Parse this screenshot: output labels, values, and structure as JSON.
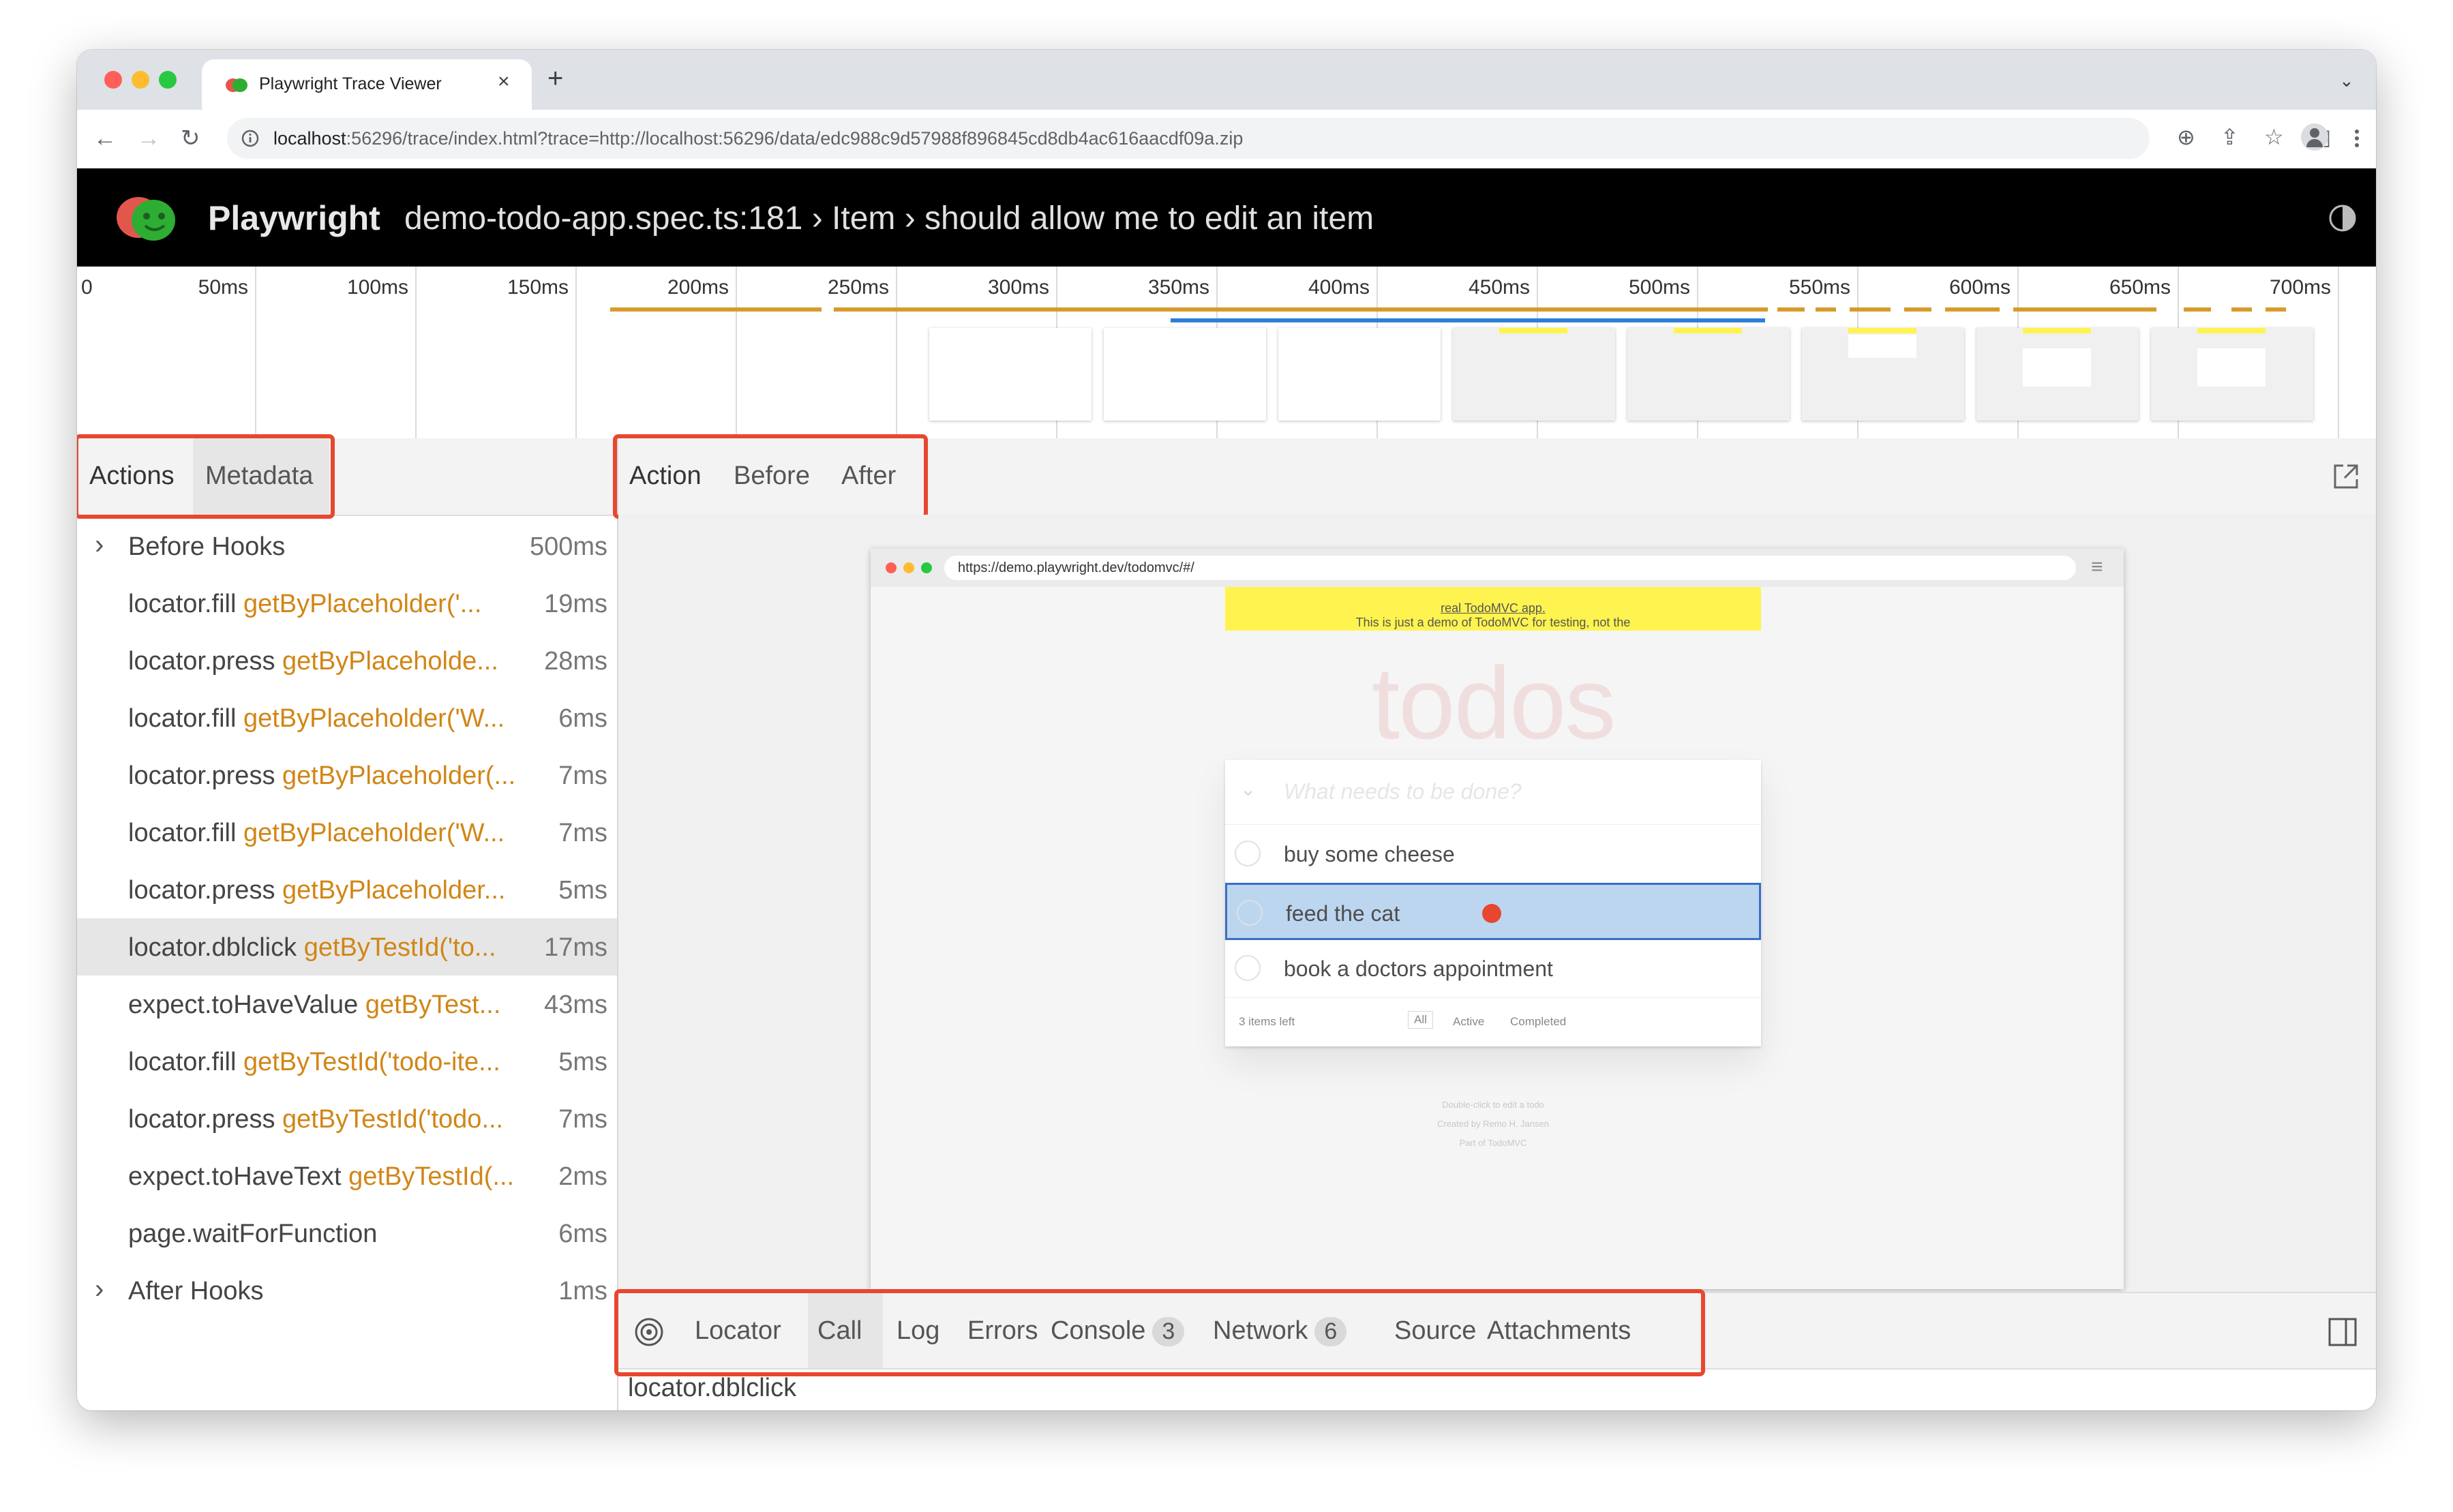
{
  "browser": {
    "tab_title": "Playwright Trace Viewer",
    "tab_close": "×",
    "new_tab": "+",
    "url_host": "localhost",
    "url_rest": ":56296/trace/index.html?trace=http://localhost:56296/data/edc988c9d57988f896845cd8db4ac616aacdf09a.zip",
    "traffic_colors": [
      "#ff5f57",
      "#febc2e",
      "#28c840"
    ]
  },
  "header": {
    "brand": "Playwright",
    "title": "demo-todo-app.spec.ts:181 › Item › should allow me to edit an item"
  },
  "timeline": {
    "ticks": [
      "0",
      "50ms",
      "100ms",
      "150ms",
      "200ms",
      "250ms",
      "300ms",
      "350ms",
      "400ms",
      "450ms",
      "500ms",
      "550ms",
      "600ms",
      "650ms",
      "700ms"
    ]
  },
  "left_tabs": [
    "Actions",
    "Metadata"
  ],
  "actions": [
    {
      "method": "Before Hooks",
      "selector": "",
      "time": "500ms",
      "expandable": true
    },
    {
      "method": "locator.fill",
      "selector": "getByPlaceholder('...",
      "time": "19ms"
    },
    {
      "method": "locator.press",
      "selector": "getByPlaceholde...",
      "time": "28ms"
    },
    {
      "method": "locator.fill",
      "selector": "getByPlaceholder('W...",
      "time": "6ms"
    },
    {
      "method": "locator.press",
      "selector": "getByPlaceholder(...",
      "time": "7ms"
    },
    {
      "method": "locator.fill",
      "selector": "getByPlaceholder('W...",
      "time": "7ms"
    },
    {
      "method": "locator.press",
      "selector": "getByPlaceholder...",
      "time": "5ms"
    },
    {
      "method": "locator.dblclick",
      "selector": "getByTestId('to...",
      "time": "17ms",
      "selected": true
    },
    {
      "method": "expect.toHaveValue",
      "selector": "getByTest...",
      "time": "43ms"
    },
    {
      "method": "locator.fill",
      "selector": "getByTestId('todo-ite...",
      "time": "5ms"
    },
    {
      "method": "locator.press",
      "selector": "getByTestId('todo...",
      "time": "7ms"
    },
    {
      "method": "expect.toHaveText",
      "selector": "getByTestId(...",
      "time": "2ms"
    },
    {
      "method": "page.waitForFunction",
      "selector": "",
      "time": "6ms"
    },
    {
      "method": "After Hooks",
      "selector": "",
      "time": "1ms",
      "expandable": true
    }
  ],
  "snapshot_tabs": [
    "Action",
    "Before",
    "After"
  ],
  "snapshot": {
    "url": "https://demo.playwright.dev/todomvc/#/",
    "banner_text": "This is just a demo of TodoMVC for testing, not the ",
    "banner_link": "real TodoMVC app.",
    "app_title": "todos",
    "input_placeholder": "What needs to be done?",
    "items": [
      "buy some cheese",
      "feed the cat",
      "book a doctors appointment"
    ],
    "highlighted_index": 1,
    "footer": {
      "count": "3 items left",
      "filters": [
        "All",
        "Active",
        "Completed"
      ]
    },
    "info": [
      "Double-click to edit a todo",
      "Created by Remo H. Jansen",
      "Part of TodoMVC"
    ]
  },
  "bottom_tabs": [
    {
      "label": "Locator"
    },
    {
      "label": "Call",
      "selected": true
    },
    {
      "label": "Log"
    },
    {
      "label": "Errors"
    },
    {
      "label": "Console",
      "badge": "3"
    },
    {
      "label": "Network",
      "badge": "6"
    },
    {
      "label": "Source"
    },
    {
      "label": "Attachments"
    }
  ],
  "call_detail": "locator.dblclick",
  "colors": {
    "highlight_box": "#e8472f",
    "selector": "#d18616",
    "timeline_orange": "#d89a2c",
    "timeline_blue": "#2f7fd8"
  }
}
